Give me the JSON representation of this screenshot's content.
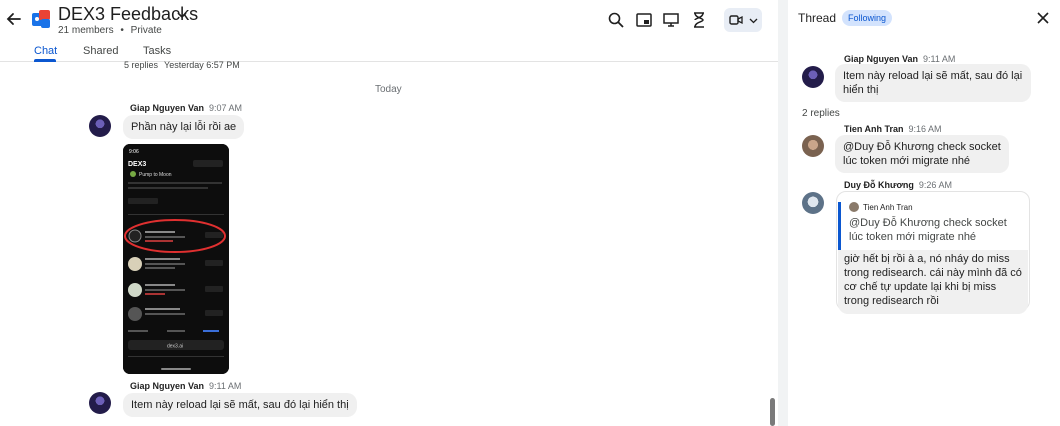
{
  "header": {
    "title": "DEX3 Feedbacks",
    "members": "21 members",
    "separator": "•",
    "privacy": "Private"
  },
  "tabs": [
    {
      "label": "Chat",
      "active": true
    },
    {
      "label": "Shared",
      "active": false
    },
    {
      "label": "Tasks",
      "active": false
    }
  ],
  "chat": {
    "prev_replies": "5 replies",
    "prev_replies_time": "Yesterday 6:57 PM",
    "day_divider": "Today",
    "messages": [
      {
        "sender": "Giap Nguyen Van",
        "time": "9:07 AM",
        "text": "Phần này lại lỗi rồi ae"
      },
      {
        "sender": "Giap Nguyen Van",
        "time": "9:11 AM",
        "text": "Item này reload lại sẽ mất, sau đó lại hiển thị"
      }
    ],
    "screenshot": {
      "time": "9:06",
      "brand": "DEX3",
      "heading": "Pump to Moon",
      "url": "dex3.ai"
    }
  },
  "thread": {
    "title": "Thread",
    "follow_label": "Following",
    "root": {
      "sender": "Giap Nguyen Van",
      "time": "9:11 AM",
      "text": "Item này reload lại sẽ mất, sau đó lại hiển thị"
    },
    "replies_count": "2 replies",
    "replies": [
      {
        "sender": "Tien Anh Tran",
        "time": "9:16 AM",
        "mention": "@Duy Đỗ Khương",
        "text": "check socket lúc token mới migrate nhé"
      },
      {
        "sender": "Duy Đỗ Khương",
        "time": "9:26 AM",
        "quote_sender": "Tien Anh Tran",
        "quote_text": "@Duy Đỗ Khương check socket lúc token mới migrate nhé",
        "text": "giờ hết bị rồi à a, nó nháy do miss trong redisearch. cái này mình đã có cơ chế tự update lại khi bị miss trong redisearch rồi"
      }
    ]
  },
  "colors": {
    "accent": "#0b57d0",
    "bubble": "#f0f0f0",
    "follow_bg": "#d3e3fd"
  }
}
